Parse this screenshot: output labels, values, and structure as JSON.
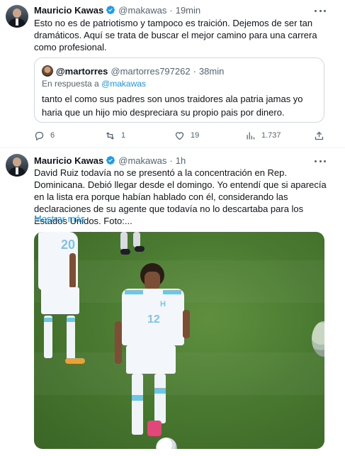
{
  "tweets": [
    {
      "author_name": "Mauricio Kawas",
      "handle": "@makawas",
      "separator": "·",
      "time": "19min",
      "text": "Esto no es de patriotismo y tampoco es traición. Dejemos de ser tan dramáticos. Aquí se trata de buscar el mejor camino para una carrera como profesional.",
      "quoted": {
        "author_name": "@martorres",
        "handle": "@martorres797262",
        "separator": "·",
        "time": "38min",
        "reply_prefix": "En respuesta a",
        "reply_to": "@makawas",
        "text": "tanto el como sus padres  son unos traidores ala patria jamas yo haria que un hijo mio despreciara su propio pais por dinero."
      },
      "actions": {
        "replies": "6",
        "retweets": "1",
        "likes": "19",
        "views": "1.737"
      }
    },
    {
      "author_name": "Mauricio Kawas",
      "handle": "@makawas",
      "separator": "·",
      "time": "1h",
      "text": "David Ruiz todavía no se presentó a la concentración en Rep. Dominicana. Debió llegar desde el domingo. Yo entendí que si aparecía en la lista era porque habían hablado con él, considerando las declaraciones de su agente que todavía no lo descartaba para los Estados Unidos. Foto:...",
      "show_more": "Mostrar más",
      "photo": {
        "jersey_numbers": [
          "20",
          "12"
        ],
        "crest_letter": "H"
      }
    }
  ],
  "colors": {
    "accent": "#1d9bf0",
    "muted": "#536471",
    "border": "#cfd9de"
  },
  "icons": [
    "more-icon",
    "verified-badge-icon",
    "reply-icon",
    "retweet-icon",
    "like-icon",
    "views-icon",
    "share-icon"
  ]
}
